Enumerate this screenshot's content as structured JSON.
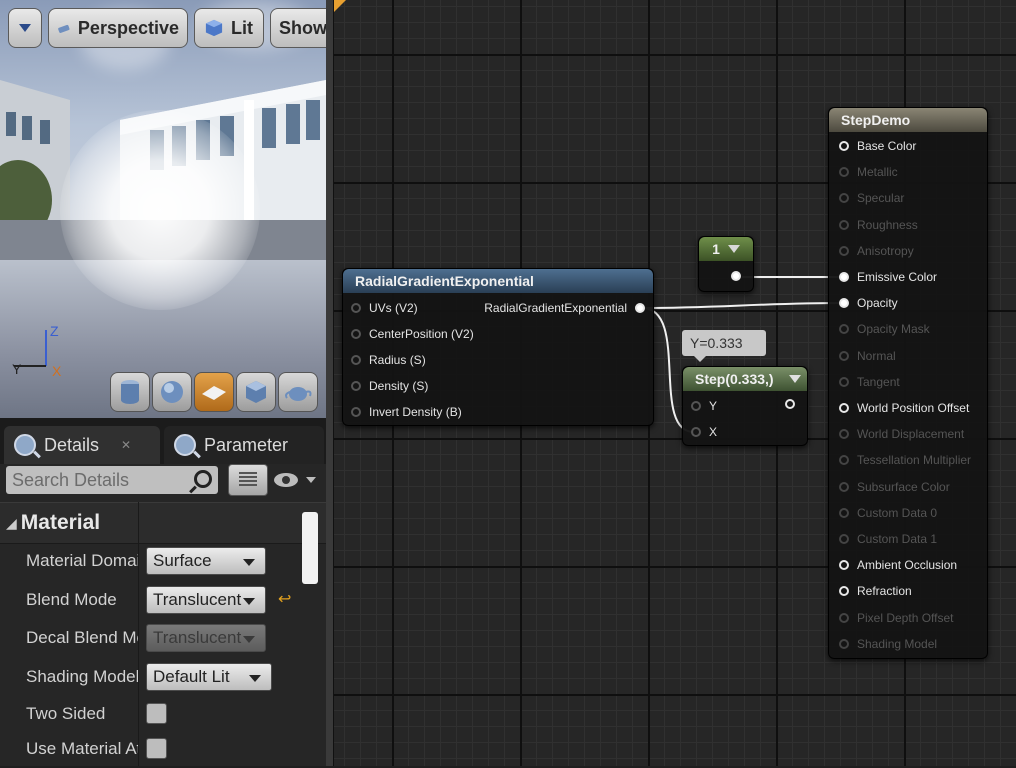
{
  "viewport": {
    "toolbar": {
      "perspective_label": "Perspective",
      "lit_label": "Lit",
      "show_label": "Show"
    },
    "axis": {
      "z": "Z",
      "y": "Y",
      "x": "X"
    }
  },
  "details_panel": {
    "tabs": [
      {
        "label": "Details"
      },
      {
        "label": "Parameter"
      }
    ],
    "search_placeholder": "Search Details",
    "category": "Material",
    "properties": [
      {
        "label": "Material Domai",
        "value": "Surface"
      },
      {
        "label": "Blend Mode",
        "value": "Translucent"
      },
      {
        "label": "Decal Blend Mo",
        "value": "Translucent"
      },
      {
        "label": "Shading Model",
        "value": "Default Lit"
      },
      {
        "label": "Two Sided"
      },
      {
        "label": "Use Material At"
      }
    ]
  },
  "graph": {
    "radial_node": {
      "title": "RadialGradientExponential",
      "inputs": [
        "UVs (V2)",
        "CenterPosition (V2)",
        "Radius (S)",
        "Density (S)",
        "Invert Density (B)"
      ],
      "output": "RadialGradientExponential"
    },
    "constant_node": {
      "value": "1"
    },
    "step_node": {
      "title": "Step(0.333,)",
      "tooltip": "Y=0.333",
      "inputs": [
        "Y",
        "X"
      ]
    },
    "result_node": {
      "title": "StepDemo",
      "pins": [
        {
          "label": "Base Color",
          "state": "hollow"
        },
        {
          "label": "Metallic",
          "state": "dim"
        },
        {
          "label": "Specular",
          "state": "dim"
        },
        {
          "label": "Roughness",
          "state": "dim"
        },
        {
          "label": "Anisotropy",
          "state": "dim"
        },
        {
          "label": "Emissive Color",
          "state": "on"
        },
        {
          "label": "Opacity",
          "state": "on"
        },
        {
          "label": "Opacity Mask",
          "state": "dim"
        },
        {
          "label": "Normal",
          "state": "dim"
        },
        {
          "label": "Tangent",
          "state": "dim"
        },
        {
          "label": "World Position Offset",
          "state": "hollow"
        },
        {
          "label": "World Displacement",
          "state": "dim"
        },
        {
          "label": "Tessellation Multiplier",
          "state": "dim"
        },
        {
          "label": "Subsurface Color",
          "state": "dim"
        },
        {
          "label": "Custom Data 0",
          "state": "dim"
        },
        {
          "label": "Custom Data 1",
          "state": "dim"
        },
        {
          "label": "Ambient Occlusion",
          "state": "hollow"
        },
        {
          "label": "Refraction",
          "state": "hollow"
        },
        {
          "label": "Pixel Depth Offset",
          "state": "dim"
        },
        {
          "label": "Shading Model",
          "state": "dim"
        }
      ]
    }
  },
  "colors": {
    "radial_title": "#3d5a75",
    "constant_title": "#5b7a3a",
    "step_title": "#5d7250",
    "result_title": "#6e6a5a",
    "accent_orange": "#e8a030"
  }
}
